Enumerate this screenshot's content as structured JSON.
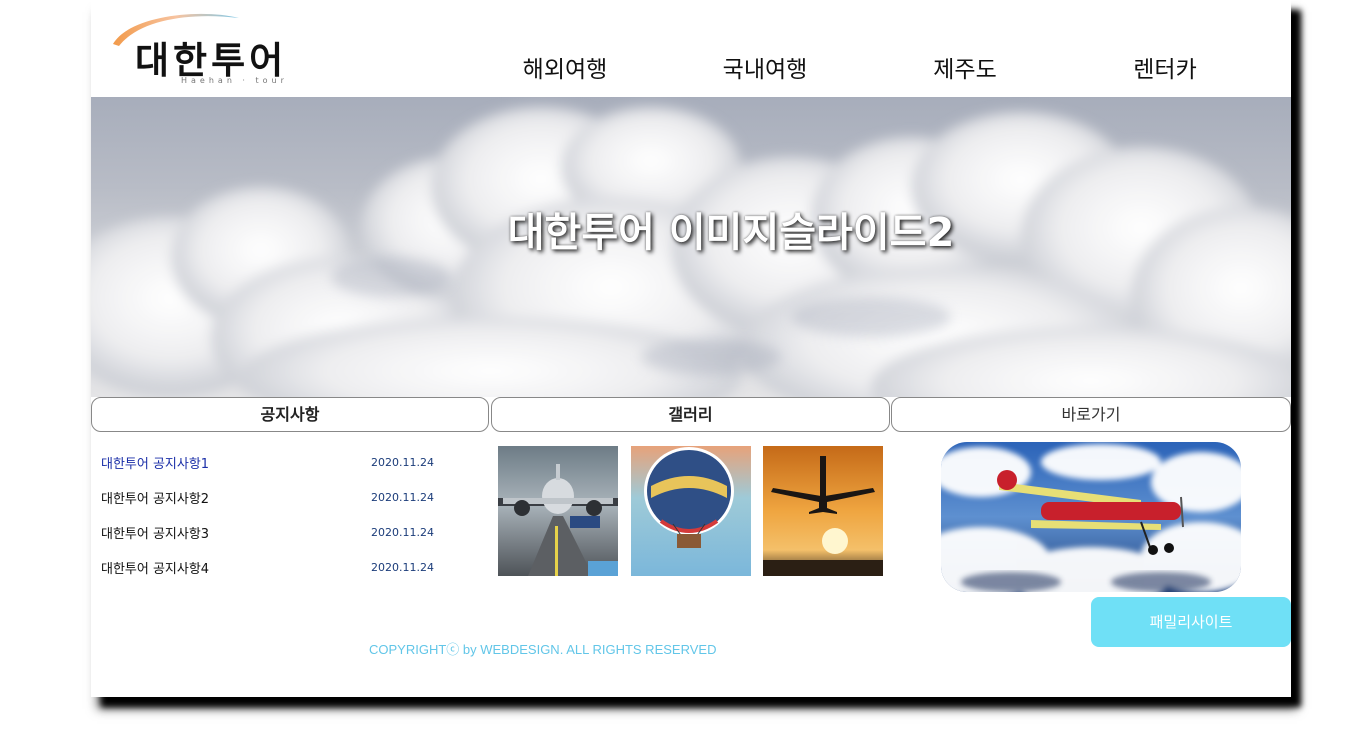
{
  "logo": {
    "text": "대한투어",
    "sub": "Haehan · tour",
    "accent_colors": [
      "#f2a65a",
      "#7fc8e8"
    ]
  },
  "nav": {
    "items": [
      {
        "label": "해외여행"
      },
      {
        "label": "국내여행"
      },
      {
        "label": "제주도"
      },
      {
        "label": "렌터카"
      }
    ]
  },
  "hero": {
    "title": "대한투어 이미지슬라이드2",
    "image": "sky-clouds"
  },
  "sections": {
    "notice_tab": "공지사항",
    "gallery_tab": "갤러리",
    "shortcut_tab": "바로가기"
  },
  "notices": [
    {
      "title": "대한투어 공지사항1",
      "date": "2020.11.24"
    },
    {
      "title": "대한투어 공지사항2",
      "date": "2020.11.24"
    },
    {
      "title": "대한투어 공지사항3",
      "date": "2020.11.24"
    },
    {
      "title": "대한투어 공지사항4",
      "date": "2020.11.24"
    }
  ],
  "gallery": [
    {
      "image": "airliner-on-runway"
    },
    {
      "image": "hot-air-balloon"
    },
    {
      "image": "plane-at-sunset"
    }
  ],
  "shortcut": {
    "image": "biplane-in-clouds"
  },
  "family_site": {
    "label": "패밀리사이트",
    "color": "#6fe0f6"
  },
  "footer": {
    "copyright": "COPYRIGHTⓒ by WEBDESIGN. ALL RIGHTS RESERVED",
    "color": "#62c6e8"
  }
}
